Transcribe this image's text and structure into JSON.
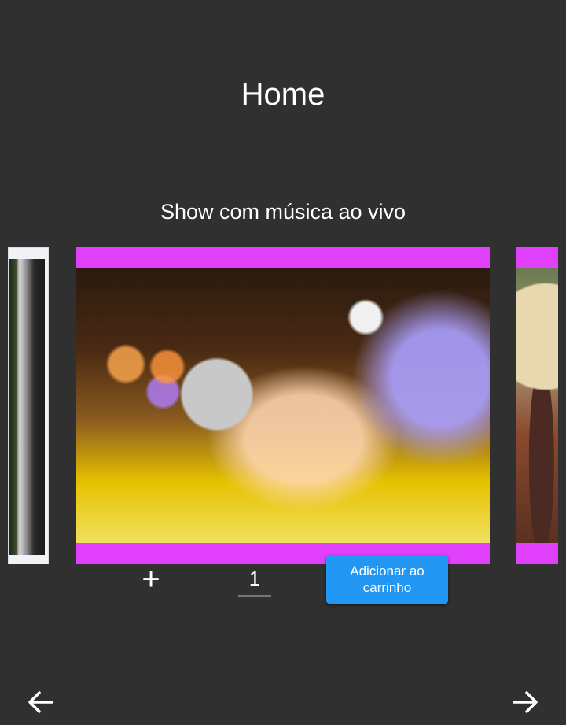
{
  "page": {
    "title": "Home"
  },
  "carousel": {
    "current_item": {
      "name": "Show com música ao vivo"
    },
    "quantity": "1",
    "add_to_cart_label": "Adicionar ao carrinho"
  },
  "icons": {
    "increment": "plus-icon",
    "previous": "arrow-left-icon",
    "next": "arrow-right-icon"
  },
  "colors": {
    "background": "#303030",
    "card_frame": "#e040fb",
    "button": "#2196f3",
    "text": "#ffffff"
  }
}
